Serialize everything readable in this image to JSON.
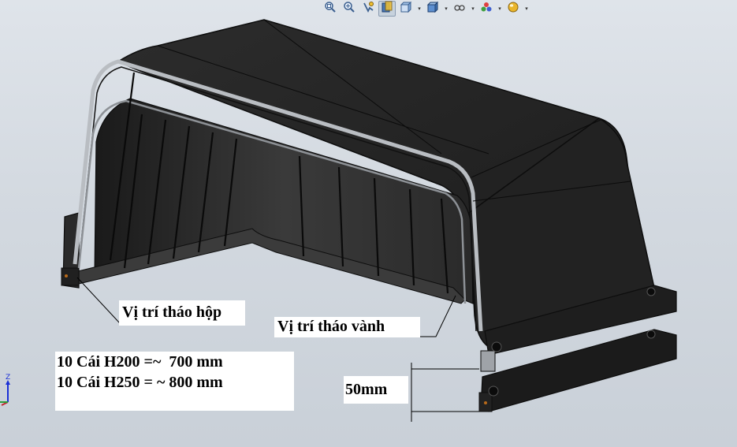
{
  "toolbar": {
    "items": [
      {
        "name": "zoom-to-fit-icon",
        "dropdown": false,
        "active": false
      },
      {
        "name": "zoom-to-area-icon",
        "dropdown": false,
        "active": false
      },
      {
        "name": "previous-view-icon",
        "dropdown": false,
        "active": false
      },
      {
        "name": "section-view-icon",
        "dropdown": false,
        "active": true
      },
      {
        "name": "view-orientation-icon",
        "dropdown": true,
        "active": false
      },
      {
        "name": "display-style-icon",
        "dropdown": true,
        "active": false
      },
      {
        "name": "hide-show-items-icon",
        "dropdown": true,
        "active": false
      },
      {
        "name": "edit-appearance-icon",
        "dropdown": true,
        "active": false
      },
      {
        "name": "apply-scene-icon",
        "dropdown": true,
        "active": false
      }
    ]
  },
  "annotations": {
    "hop": "Vị trí tháo hộp",
    "vanh": "Vị trí tháo vành",
    "qty_line1": "10 Cái H200 =~  700 mm",
    "qty_line2": "10 Cái H250 = ~ 800 mm",
    "dimension": "50mm"
  },
  "triad": {
    "axis_label": "Z",
    "color": "#1a2fd6"
  },
  "colors": {
    "part_dark": "#262626",
    "part_edge": "#0d0d0d",
    "rim_highlight": "#b9bdc2",
    "background": "#d5dbe2"
  }
}
